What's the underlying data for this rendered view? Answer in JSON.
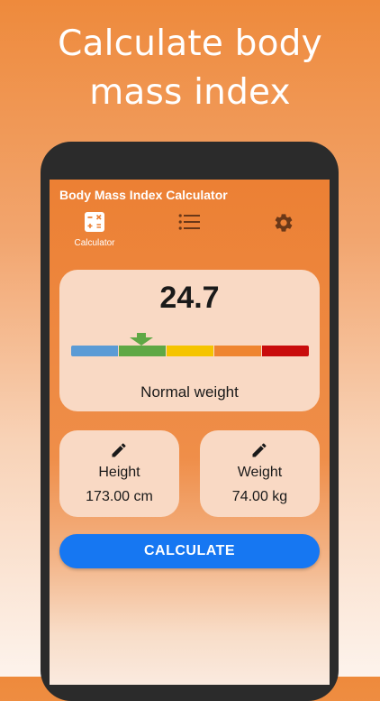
{
  "headline": {
    "line1": "Calculate body",
    "line2": "mass index"
  },
  "app": {
    "title": "Body Mass Index Calculator"
  },
  "tabs": [
    {
      "label": "Calculator",
      "icon": "calculator-icon",
      "active": true
    },
    {
      "label": "",
      "icon": "list-icon",
      "active": false
    },
    {
      "label": "",
      "icon": "gear-icon",
      "active": false
    }
  ],
  "result": {
    "bmi": "24.7",
    "category": "Normal weight",
    "scale_colors": [
      "#5b9bd5",
      "#5fa845",
      "#f5c400",
      "#ef8530",
      "#c90c0c"
    ],
    "pointer_segment": 1,
    "pointer_color": "#5fa845"
  },
  "height": {
    "label": "Height",
    "value": "173.00 cm"
  },
  "weight": {
    "label": "Weight",
    "value": "74.00 kg"
  },
  "calculate_label": "CALCULATE",
  "colors": {
    "accent": "#ec8034",
    "card": "#f9d9c4",
    "button": "#1677f2"
  }
}
